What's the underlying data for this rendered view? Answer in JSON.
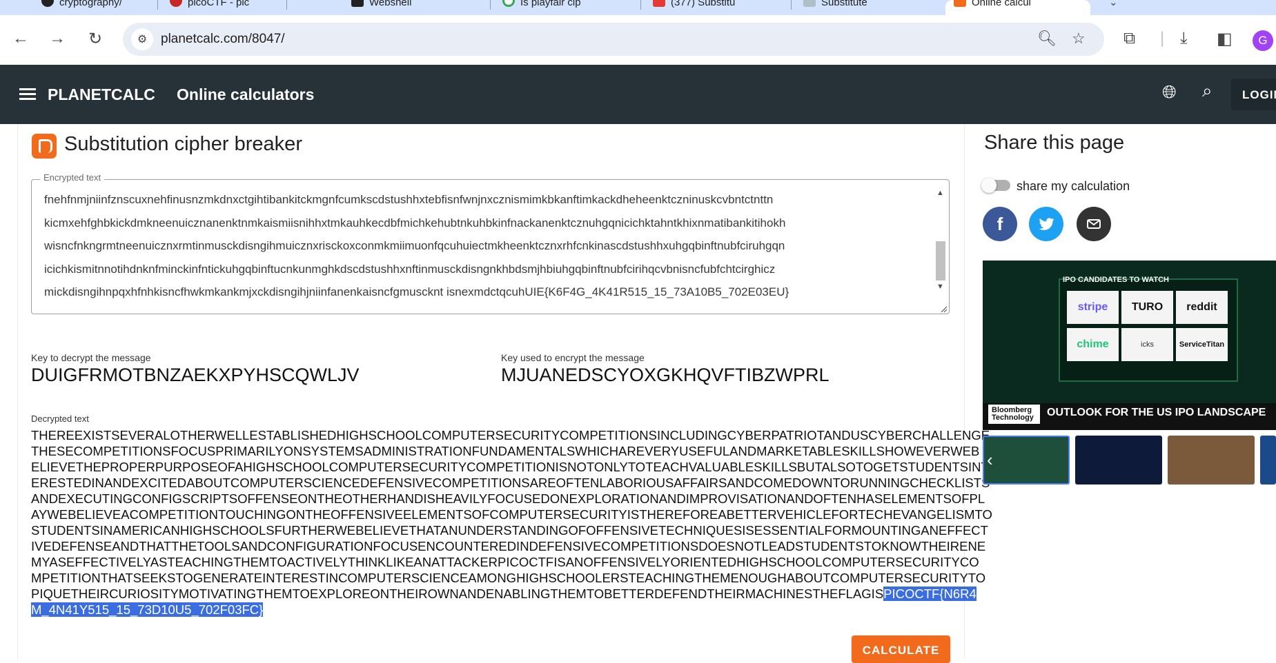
{
  "browser": {
    "tabs": [
      {
        "label": "cryptography/",
        "active": false
      },
      {
        "label": "picoCTF - pic",
        "active": false
      },
      {
        "label": "Webshell",
        "active": false
      },
      {
        "label": "Is playfair cip",
        "active": false
      },
      {
        "label": "(377) Substitu",
        "active": false
      },
      {
        "label": "Substitute",
        "active": false
      },
      {
        "label": "Online calcul",
        "active": true
      }
    ],
    "url": "planetcalc.com/8047/",
    "avatar_letter": "G"
  },
  "appbar": {
    "brand": "PLANETCALC",
    "subtitle": "Online calculators",
    "login_label": "LOGIN"
  },
  "calculator": {
    "title": "Substitution cipher breaker",
    "encrypted_label": "Encrypted text",
    "encrypted_lines": [
      "fnehfnmjniinfznscuxnehfinusnzmkdnxctgihtibankitckmgnfcumkscdstushhxtebfisnfwnjnxcznismimkbkanftimkackdheheenktczninuskcvbntctnttn",
      "kicmxehfghbkickdmkneenuicznanenktnmkaismiisnihhxtmkauhkecdbfmichkehubtnkuhbkinfnackanenktcznuhgqnicichktahntkhixnmatibankitihokh",
      "wisncfnkngrmtneenuicznxrmtinmusckdisngihmuicznxrisckoxconmkmiimuonfqcuhuiectmkheenktcznxrhfcnkinascdstushhxuhgqbinftnubfciruhgqn",
      "icichkismitnnotihdnknfminckinfntickuhgqbinftucnkunmghkdscdstushhxnftinmusckdisngnkhbdsmjhbiuhgqbinftnubfcirihqcvbnisncfubfchtcirghicz",
      "mickdisngihnpqxhfnhkisncfhwkmkankmjxckdisngihjniinfanenkaisncfgmuscknt isnexmdctqcuhUIE{K6F4G_4K41R515_15_73A10B5_702E03EU}"
    ],
    "key_decrypt_label": "Key to decrypt the message",
    "key_decrypt": "DUIGFRMOTBNZAEKXPYHSCQWLJV",
    "key_encrypt_label": "Key used to encrypt the message",
    "key_encrypt": "MJUANEDSCYOXGKHQVFTIBZWPRL",
    "decrypted_label": "Decrypted text",
    "decrypted_lines": [
      "THEREEXISTSEVERALOTHERWELLESTABLISHEDHIGHSCHOOLCOMPUTERSECURITYCOMPETITIONSINCLUDINGCYBERPATRIOTANDUSCYBERCHALLENGE",
      "THESECOMPETITIONSFOCUSPRIMARILYONSYSTEMSADMINISTRATIONFUNDAMENTALSWHICHAREVERYUSEFULANDMARKETABLESKILLSHOWEVERWEB",
      "ELIEVETHEPROPERPURPOSEOFAHIGHSCHOOLCOMPUTERSECURITYCOMPETITIONISNOTONLYTOTEACHVALUABLESKILLSBUTALSOTOGETSTUDENTSINT",
      "ERESTEDINANDEXCITEDABOUTCOMPUTERSCIENCEDEFENSIVECOMPETITIONSAREOFTENLABORIOUSAFFAIRSANDCOMEDOWNTORUNNINGCHECKLISTS",
      "ANDEXECUTINGCONFIGSCRIPTSOFFENSEONTHEOTHERHANDISHEAVILYFOCUSEDONEXPLORATIONANDIMPROVISATIONANDOFTENHASELEMENTSOFPL",
      "AYWEBELIEVEACOMPETITIONTOUCHINGONTHEOFFENSIVEELEMENTSOFCOMPUTERSECURITYISTHEREFOREABETTERVEHICLEFORTECHEVANGELISMTO",
      "STUDENTSINAMERICANHIGHSCHOOLSFURTHERWEBELIEVETHATANUNDERSTANDINGOFOFFENSIVETECHNIQUESISESSENTIALFORMOUNTINGANEFFECT",
      "IVEDEFENSEANDTHATTHETOOLSANDCONFIGURATIONFOCUSENCOUNTEREDINDEFENSIVECOMPETITIONSDOESNOTLEADSTUDENTSTOKNOWTHEIRENE",
      "MYASEFFECTIVELYASTEACHINGTHEMTOACTIVELYTHINKLIKEANATTACKERPICOCTFISANOFFENSIVELYORIENTEDHIGHSCHOOLCOMPUTERSECURITYCO",
      "MPETITIONTHATSEEKSTOGENERATEINTERESTINCOMPUTERSCIENCEAMONGHIGHSCHOOLERSTEACHINGTHEMENOUGHABOUTCOMPUTERSECURITYTO"
    ],
    "decrypted_line11_plain": "PIQUETHEIRCURIOSITYMOTIVATINGTHEMTOEXPLOREONTHEIROWNANDENABLINGTHEMTOBETTERDEFENDTHEIRMACHINESTHEFLAGIS",
    "decrypted_line11_selected": "PICOCTF{N6R4",
    "decrypted_line12_selected": "M_4N41Y515_15_73D10U5_702F03FC}",
    "calculate_label": "CALCULATE"
  },
  "share": {
    "title": "Share this page",
    "toggle_label": "share my calculation",
    "toggle_on": false
  },
  "video": {
    "headline_small": "IPO CANDIDATES TO WATCH",
    "tiles": [
      "stripe",
      "TURO",
      "reddit",
      "chime",
      "icks",
      "ServiceTitan"
    ],
    "source_logo": "Bloomberg Technology",
    "headline": "OUTLOOK FOR THE US IPO LANDSCAPE"
  },
  "colors": {
    "appbar": "#263238",
    "accent": "#f26b1d",
    "selection": "#3a6ee0"
  }
}
